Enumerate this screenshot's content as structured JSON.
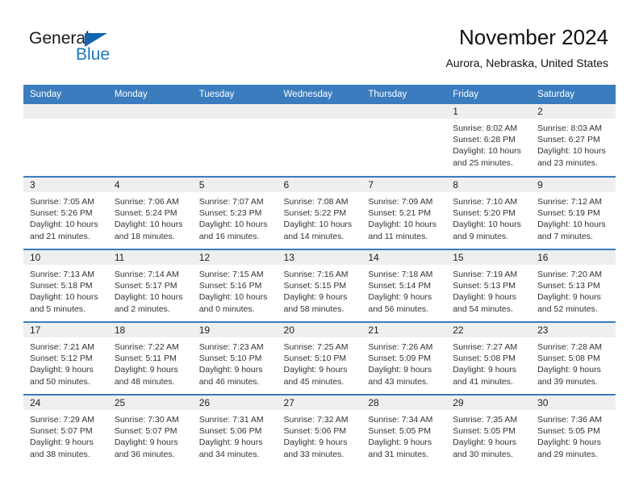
{
  "brand": {
    "name_part1": "General",
    "name_part2": "Blue",
    "triangle_icon": "triangle-icon",
    "accent_color": "#1a78c2"
  },
  "header": {
    "title": "November 2024",
    "subtitle": "Aurora, Nebraska, United States"
  },
  "calendar": {
    "header_bg": "#3a7cbe",
    "daynum_bg": "#efefef",
    "weekday_headers": [
      "Sunday",
      "Monday",
      "Tuesday",
      "Wednesday",
      "Thursday",
      "Friday",
      "Saturday"
    ],
    "weeks": [
      [
        {
          "day": "",
          "sunrise": "",
          "sunset": "",
          "daylight": ""
        },
        {
          "day": "",
          "sunrise": "",
          "sunset": "",
          "daylight": ""
        },
        {
          "day": "",
          "sunrise": "",
          "sunset": "",
          "daylight": ""
        },
        {
          "day": "",
          "sunrise": "",
          "sunset": "",
          "daylight": ""
        },
        {
          "day": "",
          "sunrise": "",
          "sunset": "",
          "daylight": ""
        },
        {
          "day": "1",
          "sunrise": "Sunrise: 8:02 AM",
          "sunset": "Sunset: 6:28 PM",
          "daylight": "Daylight: 10 hours and 25 minutes."
        },
        {
          "day": "2",
          "sunrise": "Sunrise: 8:03 AM",
          "sunset": "Sunset: 6:27 PM",
          "daylight": "Daylight: 10 hours and 23 minutes."
        }
      ],
      [
        {
          "day": "3",
          "sunrise": "Sunrise: 7:05 AM",
          "sunset": "Sunset: 5:26 PM",
          "daylight": "Daylight: 10 hours and 21 minutes."
        },
        {
          "day": "4",
          "sunrise": "Sunrise: 7:06 AM",
          "sunset": "Sunset: 5:24 PM",
          "daylight": "Daylight: 10 hours and 18 minutes."
        },
        {
          "day": "5",
          "sunrise": "Sunrise: 7:07 AM",
          "sunset": "Sunset: 5:23 PM",
          "daylight": "Daylight: 10 hours and 16 minutes."
        },
        {
          "day": "6",
          "sunrise": "Sunrise: 7:08 AM",
          "sunset": "Sunset: 5:22 PM",
          "daylight": "Daylight: 10 hours and 14 minutes."
        },
        {
          "day": "7",
          "sunrise": "Sunrise: 7:09 AM",
          "sunset": "Sunset: 5:21 PM",
          "daylight": "Daylight: 10 hours and 11 minutes."
        },
        {
          "day": "8",
          "sunrise": "Sunrise: 7:10 AM",
          "sunset": "Sunset: 5:20 PM",
          "daylight": "Daylight: 10 hours and 9 minutes."
        },
        {
          "day": "9",
          "sunrise": "Sunrise: 7:12 AM",
          "sunset": "Sunset: 5:19 PM",
          "daylight": "Daylight: 10 hours and 7 minutes."
        }
      ],
      [
        {
          "day": "10",
          "sunrise": "Sunrise: 7:13 AM",
          "sunset": "Sunset: 5:18 PM",
          "daylight": "Daylight: 10 hours and 5 minutes."
        },
        {
          "day": "11",
          "sunrise": "Sunrise: 7:14 AM",
          "sunset": "Sunset: 5:17 PM",
          "daylight": "Daylight: 10 hours and 2 minutes."
        },
        {
          "day": "12",
          "sunrise": "Sunrise: 7:15 AM",
          "sunset": "Sunset: 5:16 PM",
          "daylight": "Daylight: 10 hours and 0 minutes."
        },
        {
          "day": "13",
          "sunrise": "Sunrise: 7:16 AM",
          "sunset": "Sunset: 5:15 PM",
          "daylight": "Daylight: 9 hours and 58 minutes."
        },
        {
          "day": "14",
          "sunrise": "Sunrise: 7:18 AM",
          "sunset": "Sunset: 5:14 PM",
          "daylight": "Daylight: 9 hours and 56 minutes."
        },
        {
          "day": "15",
          "sunrise": "Sunrise: 7:19 AM",
          "sunset": "Sunset: 5:13 PM",
          "daylight": "Daylight: 9 hours and 54 minutes."
        },
        {
          "day": "16",
          "sunrise": "Sunrise: 7:20 AM",
          "sunset": "Sunset: 5:13 PM",
          "daylight": "Daylight: 9 hours and 52 minutes."
        }
      ],
      [
        {
          "day": "17",
          "sunrise": "Sunrise: 7:21 AM",
          "sunset": "Sunset: 5:12 PM",
          "daylight": "Daylight: 9 hours and 50 minutes."
        },
        {
          "day": "18",
          "sunrise": "Sunrise: 7:22 AM",
          "sunset": "Sunset: 5:11 PM",
          "daylight": "Daylight: 9 hours and 48 minutes."
        },
        {
          "day": "19",
          "sunrise": "Sunrise: 7:23 AM",
          "sunset": "Sunset: 5:10 PM",
          "daylight": "Daylight: 9 hours and 46 minutes."
        },
        {
          "day": "20",
          "sunrise": "Sunrise: 7:25 AM",
          "sunset": "Sunset: 5:10 PM",
          "daylight": "Daylight: 9 hours and 45 minutes."
        },
        {
          "day": "21",
          "sunrise": "Sunrise: 7:26 AM",
          "sunset": "Sunset: 5:09 PM",
          "daylight": "Daylight: 9 hours and 43 minutes."
        },
        {
          "day": "22",
          "sunrise": "Sunrise: 7:27 AM",
          "sunset": "Sunset: 5:08 PM",
          "daylight": "Daylight: 9 hours and 41 minutes."
        },
        {
          "day": "23",
          "sunrise": "Sunrise: 7:28 AM",
          "sunset": "Sunset: 5:08 PM",
          "daylight": "Daylight: 9 hours and 39 minutes."
        }
      ],
      [
        {
          "day": "24",
          "sunrise": "Sunrise: 7:29 AM",
          "sunset": "Sunset: 5:07 PM",
          "daylight": "Daylight: 9 hours and 38 minutes."
        },
        {
          "day": "25",
          "sunrise": "Sunrise: 7:30 AM",
          "sunset": "Sunset: 5:07 PM",
          "daylight": "Daylight: 9 hours and 36 minutes."
        },
        {
          "day": "26",
          "sunrise": "Sunrise: 7:31 AM",
          "sunset": "Sunset: 5:06 PM",
          "daylight": "Daylight: 9 hours and 34 minutes."
        },
        {
          "day": "27",
          "sunrise": "Sunrise: 7:32 AM",
          "sunset": "Sunset: 5:06 PM",
          "daylight": "Daylight: 9 hours and 33 minutes."
        },
        {
          "day": "28",
          "sunrise": "Sunrise: 7:34 AM",
          "sunset": "Sunset: 5:05 PM",
          "daylight": "Daylight: 9 hours and 31 minutes."
        },
        {
          "day": "29",
          "sunrise": "Sunrise: 7:35 AM",
          "sunset": "Sunset: 5:05 PM",
          "daylight": "Daylight: 9 hours and 30 minutes."
        },
        {
          "day": "30",
          "sunrise": "Sunrise: 7:36 AM",
          "sunset": "Sunset: 5:05 PM",
          "daylight": "Daylight: 9 hours and 29 minutes."
        }
      ]
    ]
  }
}
